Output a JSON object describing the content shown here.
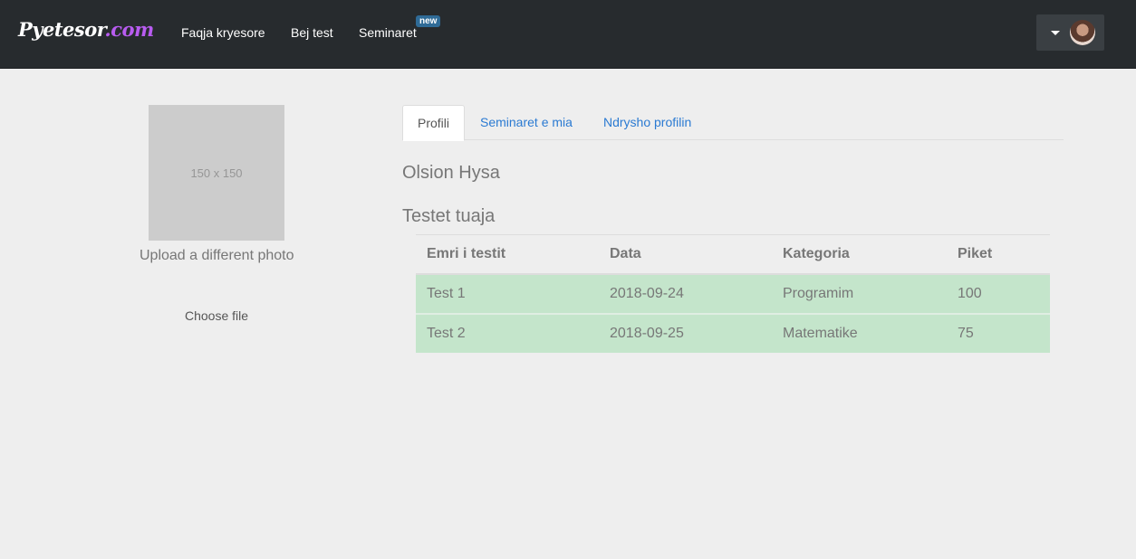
{
  "brand": {
    "part1": "Pyetesor",
    "part2": ".com"
  },
  "nav": {
    "items": [
      {
        "label": "Faqja kryesore"
      },
      {
        "label": "Bej test"
      },
      {
        "label": "Seminaret",
        "badge": "new"
      }
    ]
  },
  "sidebar": {
    "photo_placeholder": "150 x 150",
    "upload_label": "Upload a different photo",
    "choose_file": "Choose file"
  },
  "tabs": [
    {
      "label": "Profili",
      "active": true
    },
    {
      "label": "Seminaret e mia",
      "active": false
    },
    {
      "label": "Ndrysho profilin",
      "active": false
    }
  ],
  "profile": {
    "name": "Olsion Hysa"
  },
  "tests": {
    "title": "Testet tuaja",
    "columns": [
      "Emri i testit",
      "Data",
      "Kategoria",
      "Piket"
    ],
    "rows": [
      [
        "Test 1",
        "2018-09-24",
        "Programim",
        "100"
      ],
      [
        "Test 2",
        "2018-09-25",
        "Matematike",
        "75"
      ]
    ]
  },
  "colors": {
    "navbar": "#272b2e",
    "brand_accent": "#b85cf0",
    "link": "#2a7ad2",
    "row_success": "#c4e5cb",
    "badge": "#2f6b97"
  },
  "icons": {
    "dropdown": "caret-down-icon",
    "avatar": "user-avatar"
  }
}
